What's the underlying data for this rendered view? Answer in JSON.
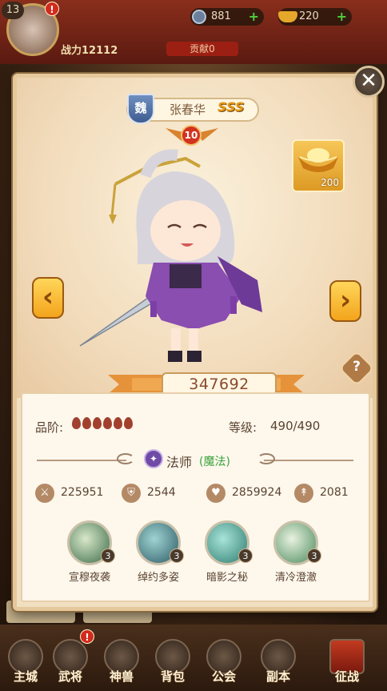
{
  "top": {
    "player_level": "13",
    "alert": "!",
    "silver": "881",
    "gold": "220",
    "power_prefix": "战力",
    "power_value": "12112",
    "contribution": "贡献0"
  },
  "hero": {
    "faction": "魏",
    "name": "张春华",
    "rarity": "SSS",
    "star": "10",
    "power": "347692",
    "grade_label": "品阶:",
    "grade_pips": 6,
    "level_label": "等级:",
    "level_value": "490/490",
    "class_name": "法师",
    "class_type": "(魔法)",
    "stats": [
      {
        "icon": "sword-icon",
        "value": "225951"
      },
      {
        "icon": "shield-icon",
        "value": "2544"
      },
      {
        "icon": "heart-icon",
        "value": "2859924"
      },
      {
        "icon": "boot-icon",
        "value": "2081"
      }
    ],
    "skills": [
      {
        "name": "宣穆夜袭",
        "level": "3",
        "color": "#3b6b4a"
      },
      {
        "name": "绰约多姿",
        "level": "3",
        "color": "#2d5a66"
      },
      {
        "name": "暗影之秘",
        "level": "3",
        "color": "#2f7c70"
      },
      {
        "name": "清冷澄澈",
        "level": "3",
        "color": "#4a8a5c"
      }
    ]
  },
  "ingot": {
    "count": "200"
  },
  "buttons": {
    "close": "✕",
    "prev": "‹",
    "next": "›",
    "help": "?"
  },
  "nav": [
    {
      "label": "主城"
    },
    {
      "label": "武将",
      "alert": "!"
    },
    {
      "label": "神兽"
    },
    {
      "label": "背包"
    },
    {
      "label": "公会"
    },
    {
      "label": "副本"
    },
    {
      "label": "征战"
    }
  ],
  "colors": {
    "panel_bg": "#f1dfc2",
    "accent_gold": "#f3a41c",
    "text_brown": "#5a4330",
    "class_green": "#3aa33a",
    "alert_red": "#d22a1c"
  }
}
